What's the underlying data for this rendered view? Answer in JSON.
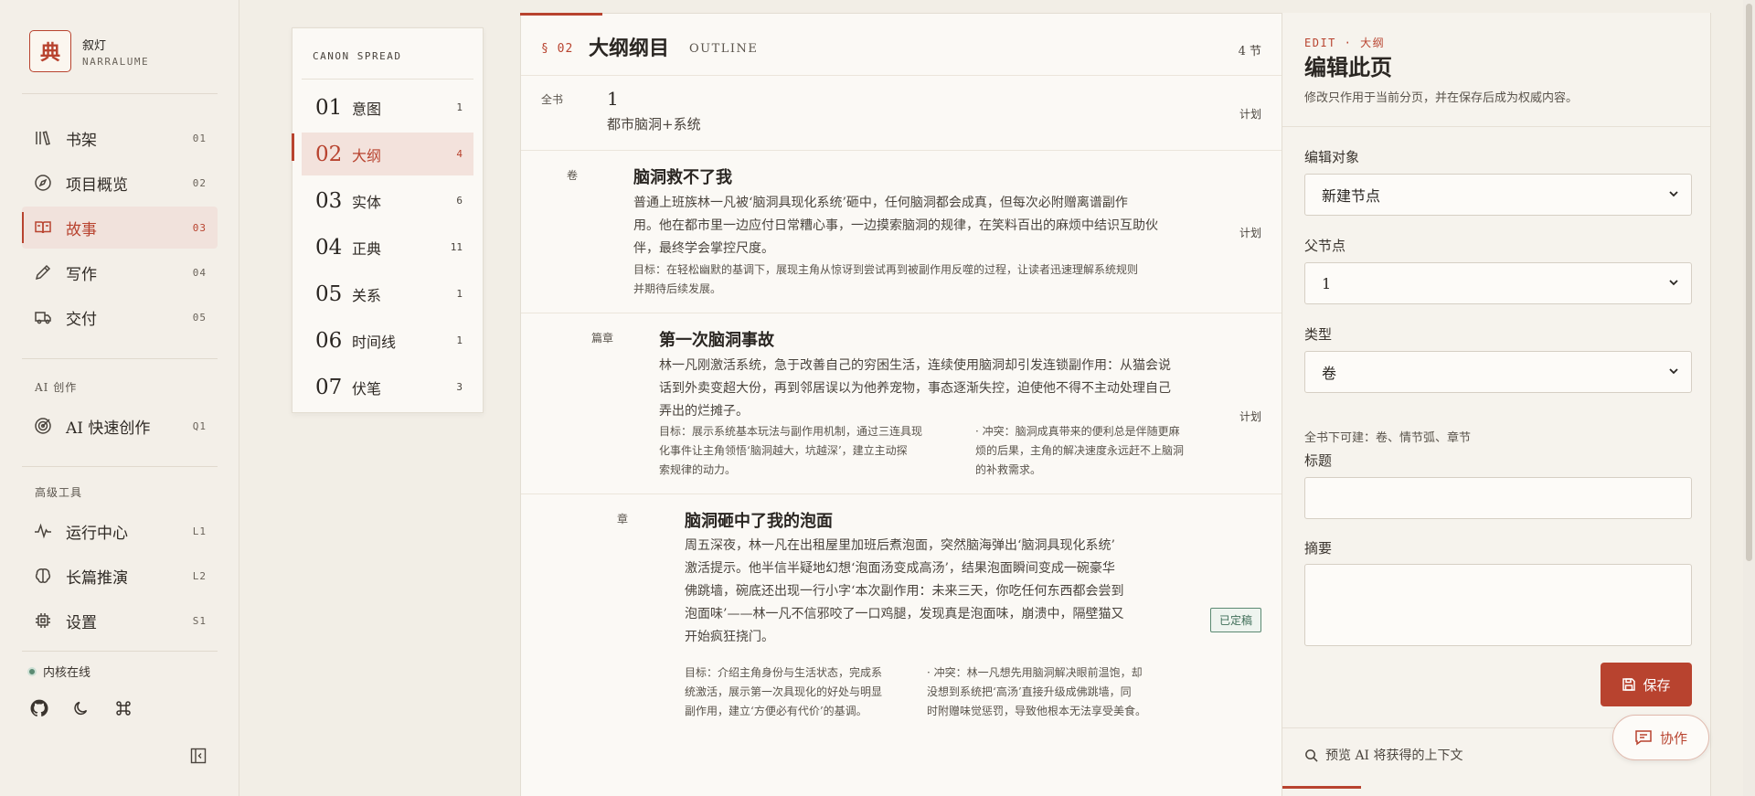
{
  "brand": {
    "logo_char": "典",
    "name_cn": "叙灯",
    "name_en": "NARRALUME"
  },
  "nav": {
    "main": [
      {
        "label": "书架",
        "code": "01",
        "icon": "bookshelf-icon"
      },
      {
        "label": "项目概览",
        "code": "02",
        "icon": "compass-icon"
      },
      {
        "label": "故事",
        "code": "03",
        "icon": "open-book-icon",
        "active": true
      },
      {
        "label": "写作",
        "code": "04",
        "icon": "pen-icon"
      },
      {
        "label": "交付",
        "code": "05",
        "icon": "truck-icon"
      }
    ],
    "ai_section": "AI 创作",
    "ai": [
      {
        "label": "AI 快速创作",
        "code": "Q1",
        "icon": "target-icon"
      }
    ],
    "adv_section": "高级工具",
    "adv": [
      {
        "label": "运行中心",
        "code": "L1",
        "icon": "pulse-icon"
      },
      {
        "label": "长篇推演",
        "code": "L2",
        "icon": "brain-icon"
      },
      {
        "label": "设置",
        "code": "S1",
        "icon": "chip-icon"
      }
    ],
    "status": "内核在线"
  },
  "canon": {
    "title": "CANON SPREAD",
    "items": [
      {
        "num": "01",
        "name": "意图",
        "count": "1"
      },
      {
        "num": "02",
        "name": "大纲",
        "count": "4",
        "active": true
      },
      {
        "num": "03",
        "name": "实体",
        "count": "6"
      },
      {
        "num": "04",
        "name": "正典",
        "count": "11"
      },
      {
        "num": "05",
        "name": "关系",
        "count": "1"
      },
      {
        "num": "06",
        "name": "时间线",
        "count": "1"
      },
      {
        "num": "07",
        "name": "伏笔",
        "count": "3"
      }
    ]
  },
  "outline": {
    "code": "§ 02",
    "title": "大纲纲目",
    "title_en": "OUTLINE",
    "count": "4 节",
    "book": {
      "kind": "全书",
      "title": "1",
      "subtitle": "都市脑洞+系统",
      "status": "计划"
    },
    "volume": {
      "kind": "卷",
      "title": "脑洞救不了我",
      "summary": [
        "普通上班族林一凡被‘脑洞具现化系统’砸中，任何脑洞都会成真，但每次必附赠离谱副作",
        "用。他在都市里一边应付日常糟心事，一边摸索脑洞的规律，在笑料百出的麻烦中结识互助伙",
        "伴，最终学会掌控尺度。"
      ],
      "goal": [
        "目标：在轻松幽默的基调下，展现主角从惊讶到尝试再到被副作用反噬的过程，让读者迅速理解系统规则",
        "并期待后续发展。"
      ],
      "status": "计划"
    },
    "arc": {
      "kind": "篇章",
      "title": "第一次脑洞事故",
      "summary": [
        "林一凡刚激活系统，急于改善自己的穷困生活，连续使用脑洞却引发连锁副作用：从猫会说",
        "话到外卖变超大份，再到邻居误以为他养宠物，事态逐渐失控，迫使他不得不主动处理自己",
        "弄出的烂摊子。"
      ],
      "goal": [
        "目标：展示系统基本玩法与副作用机制，通过三连具现",
        "化事件让主角领悟‘脑洞越大，坑越深’，建立主动探",
        "索规律的动力。"
      ],
      "conflict": [
        "· 冲突：脑洞成真带来的便利总是伴随更麻",
        "烦的后果，主角的解决速度永远赶不上脑洞",
        "的补救需求。"
      ],
      "status": "计划"
    },
    "chapter": {
      "kind": "章",
      "title": "脑洞砸中了我的泡面",
      "summary": [
        "周五深夜，林一凡在出租屋里加班后煮泡面，突然脑海弹出‘脑洞具现化系统’",
        "激活提示。他半信半疑地幻想‘泡面汤变成高汤’，结果泡面瞬间变成一碗豪华",
        "佛跳墙，碗底还出现一行小字‘本次副作用：未来三天，你吃任何东西都会尝到",
        "泡面味’——林一凡不信邪咬了一口鸡腿，发现真是泡面味，崩溃中，隔壁猫又",
        "开始疯狂挠门。"
      ],
      "goal": [
        "目标：介绍主角身份与生活状态，完成系",
        "统激活，展示第一次具现化的好处与明显",
        "副作用，建立‘方便必有代价’的基调。"
      ],
      "conflict": [
        "· 冲突：林一凡想先用脑洞解决眼前温饱，却",
        "没想到系统把‘高汤’直接升级成佛跳墙，同",
        "时附赠味觉惩罚，导致他根本无法享受美食。"
      ],
      "status": "已定稿"
    }
  },
  "edit": {
    "kicker": "EDIT · 大纲",
    "title": "编辑此页",
    "desc": "修改只作用于当前分页，并在保存后成为权威内容。",
    "target_label": "编辑对象",
    "target_value": "新建节点",
    "parent_label": "父节点",
    "parent_value": "1",
    "type_label": "类型",
    "type_value": "卷",
    "hint": "全书下可建：卷、情节弧、章节",
    "title_label": "标题",
    "title_value": "",
    "summary_label": "摘要",
    "summary_value": "",
    "save_label": "保存",
    "preview_label": "预览 AI 将获得的上下文",
    "collab_label": "协作"
  },
  "colors": {
    "accent": "#b8432f",
    "success": "#5b8a72",
    "background": "#f2eee6"
  }
}
